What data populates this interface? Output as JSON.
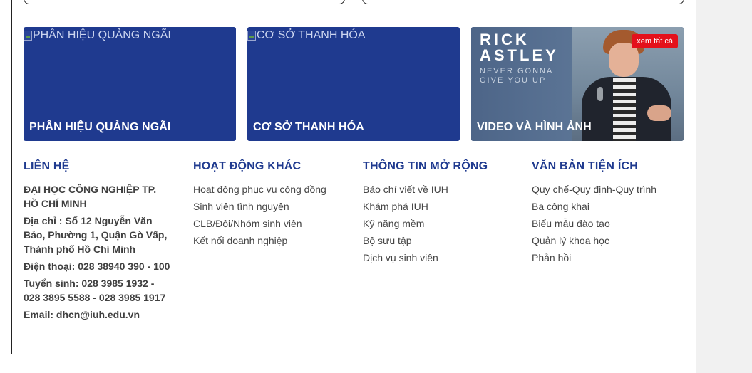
{
  "tiles": [
    {
      "broken_alt": "PHÂN HIỆU QUẢNG NGÃI",
      "caption": "PHÂN HIỆU QUẢNG NGÃI"
    },
    {
      "broken_alt": "CƠ SỞ THANH HÓA",
      "caption": "CƠ SỞ THANH HÓA"
    },
    {
      "caption": "VIDEO VÀ HÌNH ẢNH",
      "badge": "xem tất cả",
      "artwork": {
        "line1": "RICK",
        "line2": "ASTLEY",
        "line3": "NEVER GONNA",
        "line4": "GIVE YOU UP"
      }
    }
  ],
  "contact": {
    "heading": "LIÊN HỆ",
    "lines": [
      "ĐẠI HỌC CÔNG NGHIỆP TP. HỒ CHÍ MINH",
      "Địa chỉ : Số 12 Nguyễn Văn Bảo, Phường 1, Quận Gò Vấp, Thành phố Hồ Chí Minh",
      "Điện thoại: 028 38940 390 - 100",
      "Tuyển sinh: 028 3985 1932 - 028 3895 5588 - 028 3985 1917",
      "Email: dhcn@iuh.edu.vn"
    ]
  },
  "activities": {
    "heading": "HOẠT ĐỘNG KHÁC",
    "items": [
      "Hoạt động phục vụ cộng đồng",
      "Sinh viên tình nguyện",
      "CLB/Đội/Nhóm sinh viên",
      "Kết nối doanh nghiệp"
    ]
  },
  "extended": {
    "heading": "THÔNG TIN MỞ RỘNG",
    "items": [
      "Báo chí viết về IUH",
      "Khám phá IUH",
      "Kỹ năng mềm",
      "Bộ sưu tập",
      "Dịch vụ sinh viên"
    ]
  },
  "documents": {
    "heading": "VĂN BẢN TIỆN ÍCH",
    "items": [
      "Quy chế-Quy định-Quy trình",
      "Ba công khai",
      "Biểu mẫu đào tạo",
      "Quản lý khoa học",
      "Phản hồi"
    ]
  },
  "colors": {
    "brand_blue": "#1f3a8f",
    "badge_red": "#e4111b"
  }
}
